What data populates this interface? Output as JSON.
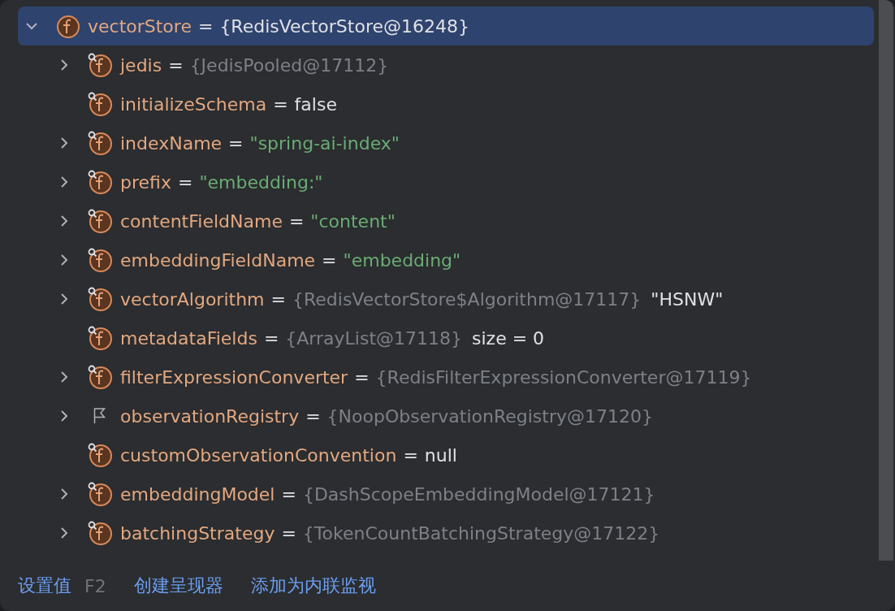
{
  "variables": [
    {
      "name": "vectorStore",
      "separator": "=",
      "kind": "field",
      "expandable": true,
      "expanded": true,
      "selected": true,
      "values": [
        {
          "kind": "plain",
          "text": "{RedisVectorStore@16248}"
        }
      ],
      "children": [
        {
          "name": "jedis",
          "separator": "=",
          "kind": "private-field",
          "expandable": true,
          "selected": false,
          "values": [
            {
              "kind": "ref",
              "text": "{JedisPooled@17112}"
            }
          ]
        },
        {
          "name": "initializeSchema",
          "separator": "=",
          "kind": "private-field",
          "expandable": false,
          "selected": false,
          "values": [
            {
              "kind": "plain",
              "text": "false"
            }
          ]
        },
        {
          "name": "indexName",
          "separator": "=",
          "kind": "private-field",
          "expandable": true,
          "selected": false,
          "values": [
            {
              "kind": "string",
              "text": "\"spring-ai-index\""
            }
          ]
        },
        {
          "name": "prefix",
          "separator": "=",
          "kind": "private-field",
          "expandable": true,
          "selected": false,
          "values": [
            {
              "kind": "string",
              "text": "\"embedding:\""
            }
          ]
        },
        {
          "name": "contentFieldName",
          "separator": "=",
          "kind": "private-field",
          "expandable": true,
          "selected": false,
          "values": [
            {
              "kind": "string",
              "text": "\"content\""
            }
          ]
        },
        {
          "name": "embeddingFieldName",
          "separator": "=",
          "kind": "private-field",
          "expandable": true,
          "selected": false,
          "values": [
            {
              "kind": "string",
              "text": "\"embedding\""
            }
          ]
        },
        {
          "name": "vectorAlgorithm",
          "separator": "=",
          "kind": "private-field",
          "expandable": true,
          "selected": false,
          "values": [
            {
              "kind": "ref",
              "text": "{RedisVectorStore$Algorithm@17117}"
            },
            {
              "kind": "plain",
              "text": "\"HSNW\""
            }
          ]
        },
        {
          "name": "metadataFields",
          "separator": "=",
          "kind": "private-field",
          "expandable": false,
          "selected": false,
          "values": [
            {
              "kind": "ref",
              "text": "{ArrayList@17118}"
            },
            {
              "kind": "plain",
              "text": "size = 0"
            }
          ]
        },
        {
          "name": "filterExpressionConverter",
          "separator": "=",
          "kind": "private-field",
          "expandable": true,
          "selected": false,
          "values": [
            {
              "kind": "ref",
              "text": "{RedisFilterExpressionConverter@17119}"
            }
          ]
        },
        {
          "name": "observationRegistry",
          "separator": "=",
          "kind": "flag",
          "expandable": true,
          "selected": false,
          "values": [
            {
              "kind": "ref",
              "text": "{NoopObservationRegistry@17120}"
            }
          ]
        },
        {
          "name": "customObservationConvention",
          "separator": "=",
          "kind": "private-field",
          "expandable": false,
          "selected": false,
          "values": [
            {
              "kind": "plain",
              "text": "null"
            }
          ]
        },
        {
          "name": "embeddingModel",
          "separator": "=",
          "kind": "private-field",
          "expandable": true,
          "selected": false,
          "values": [
            {
              "kind": "ref",
              "text": "{DashScopeEmbeddingModel@17121}"
            }
          ]
        },
        {
          "name": "batchingStrategy",
          "separator": "=",
          "kind": "private-field",
          "expandable": true,
          "selected": false,
          "values": [
            {
              "kind": "ref",
              "text": "{TokenCountBatchingStrategy@17122}"
            }
          ]
        }
      ]
    }
  ],
  "footer": [
    {
      "label": "设置值",
      "shortcut": "F2"
    },
    {
      "label": "创建呈现器"
    },
    {
      "label": "添加为内联监视"
    }
  ]
}
